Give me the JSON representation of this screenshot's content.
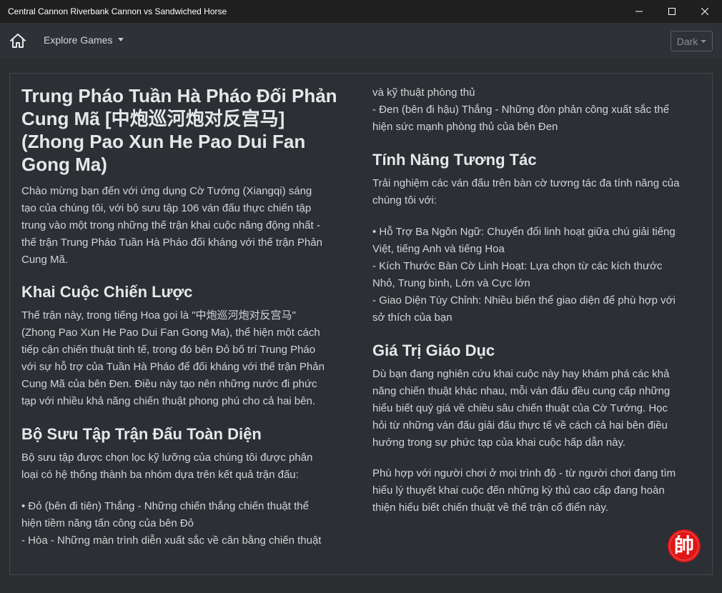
{
  "window": {
    "title": "Central Cannon Riverbank Cannon vs Sandwiched Horse"
  },
  "nav": {
    "home_icon": "home-icon",
    "explore_label": "Explore Games",
    "theme_label": "Dark"
  },
  "content": {
    "title_lines": [
      "Trung Pháo Tuần Hà Pháo Đối Phản",
      "Cung Mã [中炮巡河炮对反宫马]",
      "(Zhong Pao Xun He Pao Dui Fan",
      "Gong Ma)"
    ],
    "intro_lines": [
      "Chào mừng bạn đến với ứng dụng Cờ Tướng (Xiangqi) sáng",
      "tạo của chúng tôi, với bộ sưu tập 106 ván đấu thực chiến tập",
      "trung vào một trong những thế trận khai cuộc năng động nhất -",
      "thế trận Trung Pháo Tuần Hà Pháo đối kháng với thế trận Phản",
      "Cung Mã."
    ],
    "strategy": {
      "heading": "Khai Cuộc Chiến Lược",
      "lines": [
        "Thế trận này, trong tiếng Hoa gọi là \"中炮巡河炮对反宫马\"",
        "(Zhong Pao Xun He Pao Dui Fan Gong Ma), thể hiện một cách",
        "tiếp cận chiến thuật tinh tế, trong đó bên Đỏ bố trí Trung Pháo",
        "với sự hỗ trợ của Tuần Hà Pháo để đối kháng với thế trận Phản",
        "Cung Mã của bên Đen. Điều này tạo nên những nước đi phức",
        "tạp với nhiều khả năng chiến thuật phong phú cho cả hai bên."
      ]
    },
    "collection": {
      "heading": "Bộ Sưu Tập Trận Đấu Toàn Diện",
      "lines": [
        "Bộ sưu tập được chọn lọc kỹ lưỡng của chúng tôi được phân",
        "loại có hệ thống thành ba nhóm dựa trên kết quả trận đấu:"
      ],
      "list_lines": [
        "• Đỏ (bên đi tiên) Thắng - Những chiến thắng chiến thuật thể",
        "hiện tiềm năng tấn công của bên Đỏ",
        "- Hòa - Những màn trình diễn xuất sắc về cân bằng chiến thuật"
      ],
      "continued_lines": [
        "và kỹ thuật phòng thủ",
        "- Đen (bên đi hậu) Thắng - Những đòn phản công xuất sắc thể",
        "hiện sức mạnh phòng thủ của bên Đen"
      ]
    },
    "features": {
      "heading": "Tính Năng Tương Tác",
      "lines": [
        "Trải nghiệm các ván đấu trên bàn cờ tương tác đa tính năng của",
        "chúng tôi với:"
      ],
      "list_lines": [
        "• Hỗ Trợ Ba Ngôn Ngữ: Chuyển đổi linh hoạt giữa chú giải tiếng",
        "Việt, tiếng Anh và tiếng Hoa",
        "- Kích Thước Bàn Cờ Linh Hoạt: Lựa chọn từ các kích thước",
        "Nhỏ, Trung bình, Lớn và Cực lớn",
        "- Giao Diện Tùy Chỉnh: Nhiều biến thể giao diện để phù hợp với",
        "sở thích của bạn"
      ]
    },
    "education": {
      "heading": "Giá Trị Giáo Dục",
      "lines": [
        "Dù bạn đang nghiên cứu khai cuộc này hay khám phá các khả",
        "năng chiến thuật khác nhau, mỗi ván đấu đều cung cấp những",
        "hiểu biết quý giá về chiều sâu chiến thuật của Cờ Tướng. Học",
        "hỏi từ những ván đấu giải đấu thực tế về cách cả hai bên điều",
        "hướng trong sự phức tạp của khai cuộc hấp dẫn này."
      ],
      "closing_lines": [
        "Phù hợp với người chơi ở mọi trình độ - từ người chơi đang tìm",
        "hiểu lý thuyết khai cuộc đến những kỳ thủ cao cấp đang hoàn",
        "thiện hiểu biết chiến thuật về thế trận cổ điển này."
      ]
    }
  },
  "logo": {
    "glyph": "帥",
    "color": "#e01616"
  }
}
